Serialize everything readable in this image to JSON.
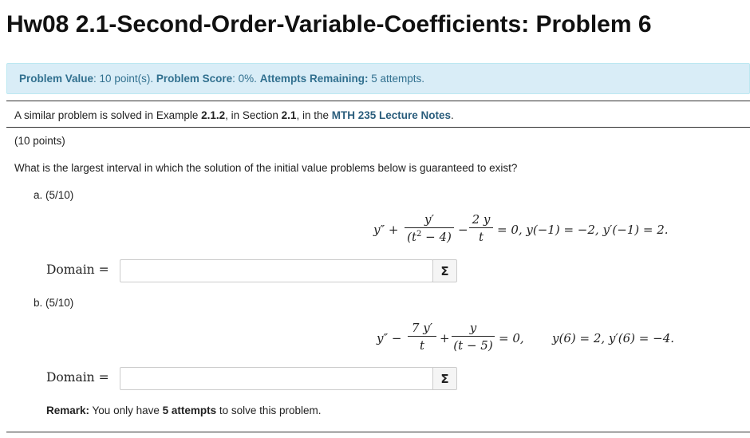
{
  "header": {
    "title": "Hw08 2.1-Second-Order-Variable-Coefficients: Problem 6"
  },
  "info": {
    "value_label": "Problem Value",
    "value_text": ": 10 point(s).",
    "score_label": "Problem Score",
    "score_text": ": 0%.",
    "attempts_label": "Attempts Remaining:",
    "attempts_text": "5 attempts."
  },
  "reference": {
    "text1": "A similar problem is solved in Example ",
    "example": "2.1.2",
    "text2": ", in Section ",
    "section": "2.1",
    "text3": ", in the ",
    "link": "MTH 235 Lecture Notes",
    "text4": "."
  },
  "problem": {
    "points": "(10 points)",
    "question": "What is the largest interval in which the solution of the initial value problems below is guaranteed to exist?"
  },
  "part_a": {
    "label": "a. (5/10)",
    "equation": {
      "lhs": "y″ +",
      "frac1_num": "y′",
      "frac1_den_pre": "(t",
      "frac1_den_sup": "2",
      "frac1_den_post": " − 4)",
      "minus": "−",
      "frac2_num": "2 y",
      "frac2_den": "t",
      "rhs": "= 0,   y(−1) = −2,   y′(−1) = 2."
    },
    "domain_label": "Domain =",
    "input_value": "",
    "sigma": "Σ"
  },
  "part_b": {
    "label": "b. (5/10)",
    "equation": {
      "lhs": "y″ −",
      "frac1_num": "7 y′",
      "frac1_den": "t",
      "plus": "+",
      "frac2_num": "y",
      "frac2_den": "(t − 5)",
      "rhs": "= 0,",
      "ic": "y(6) = 2,   y′(6) = −4."
    },
    "domain_label": "Domain =",
    "input_value": "",
    "sigma": "Σ"
  },
  "remark": {
    "label": "Remark:",
    "text1": " You only have ",
    "bold": "5 attempts",
    "text2": " to solve this problem."
  }
}
